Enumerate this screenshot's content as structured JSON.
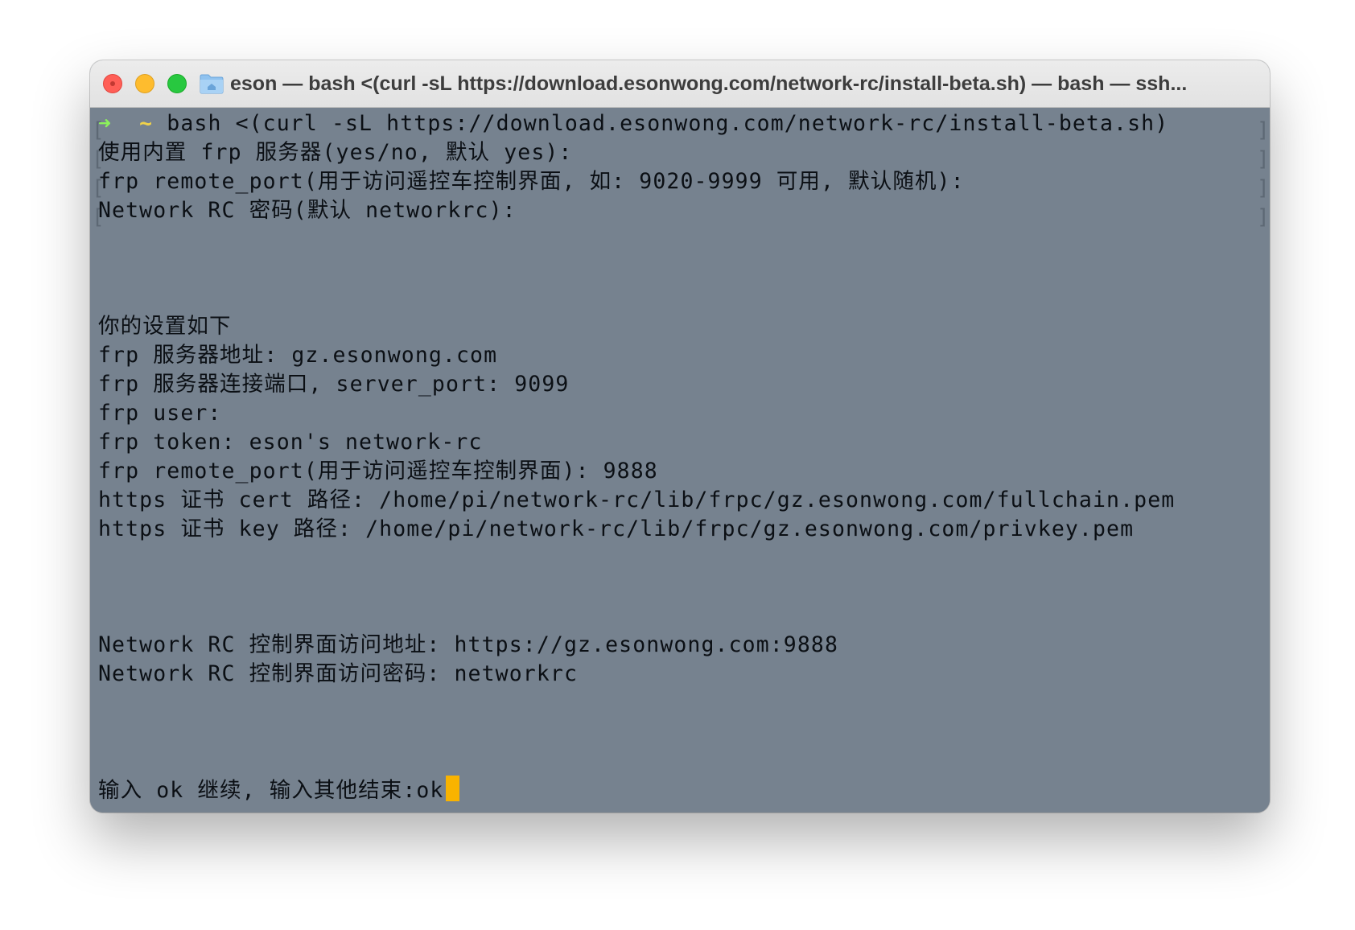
{
  "window": {
    "title": "eson — bash <(curl -sL https://download.esonwong.com/network-rc/install-beta.sh) — bash — ssh..."
  },
  "icons": {
    "close": "close-icon",
    "minimize": "minimize-icon",
    "zoom": "zoom-icon",
    "folder": "home-folder-icon"
  },
  "colors": {
    "terminal_bg": "#76828f",
    "prompt_arrow": "#8cf25b",
    "prompt_tilde": "#f0d24a",
    "cursor": "#f9b300"
  },
  "terminal": {
    "prompt_arrow": "➜",
    "prompt_tilde": "~",
    "command": "bash <(curl -sL https://download.esonwong.com/network-rc/install-beta.sh)",
    "lines": [
      "使用内置 frp 服务器(yes/no, 默认 yes):",
      "frp remote_port(用于访问遥控车控制界面, 如: 9020-9999 可用, 默认随机):",
      "Network RC 密码(默认 networkrc):",
      "",
      "",
      "",
      "你的设置如下",
      "frp 服务器地址: gz.esonwong.com",
      "frp 服务器连接端口, server_port: 9099",
      "frp user:",
      "frp token: eson's network-rc",
      "frp remote_port(用于访问遥控车控制界面): 9888",
      "https 证书 cert 路径: /home/pi/network-rc/lib/frpc/gz.esonwong.com/fullchain.pem",
      "https 证书 key 路径: /home/pi/network-rc/lib/frpc/gz.esonwong.com/privkey.pem",
      "",
      "",
      "",
      "Network RC 控制界面访问地址: https://gz.esonwong.com:9888",
      "Network RC 控制界面访问密码: networkrc",
      "",
      "",
      "",
      "输入 ok 继续, 输入其他结束:ok"
    ]
  }
}
